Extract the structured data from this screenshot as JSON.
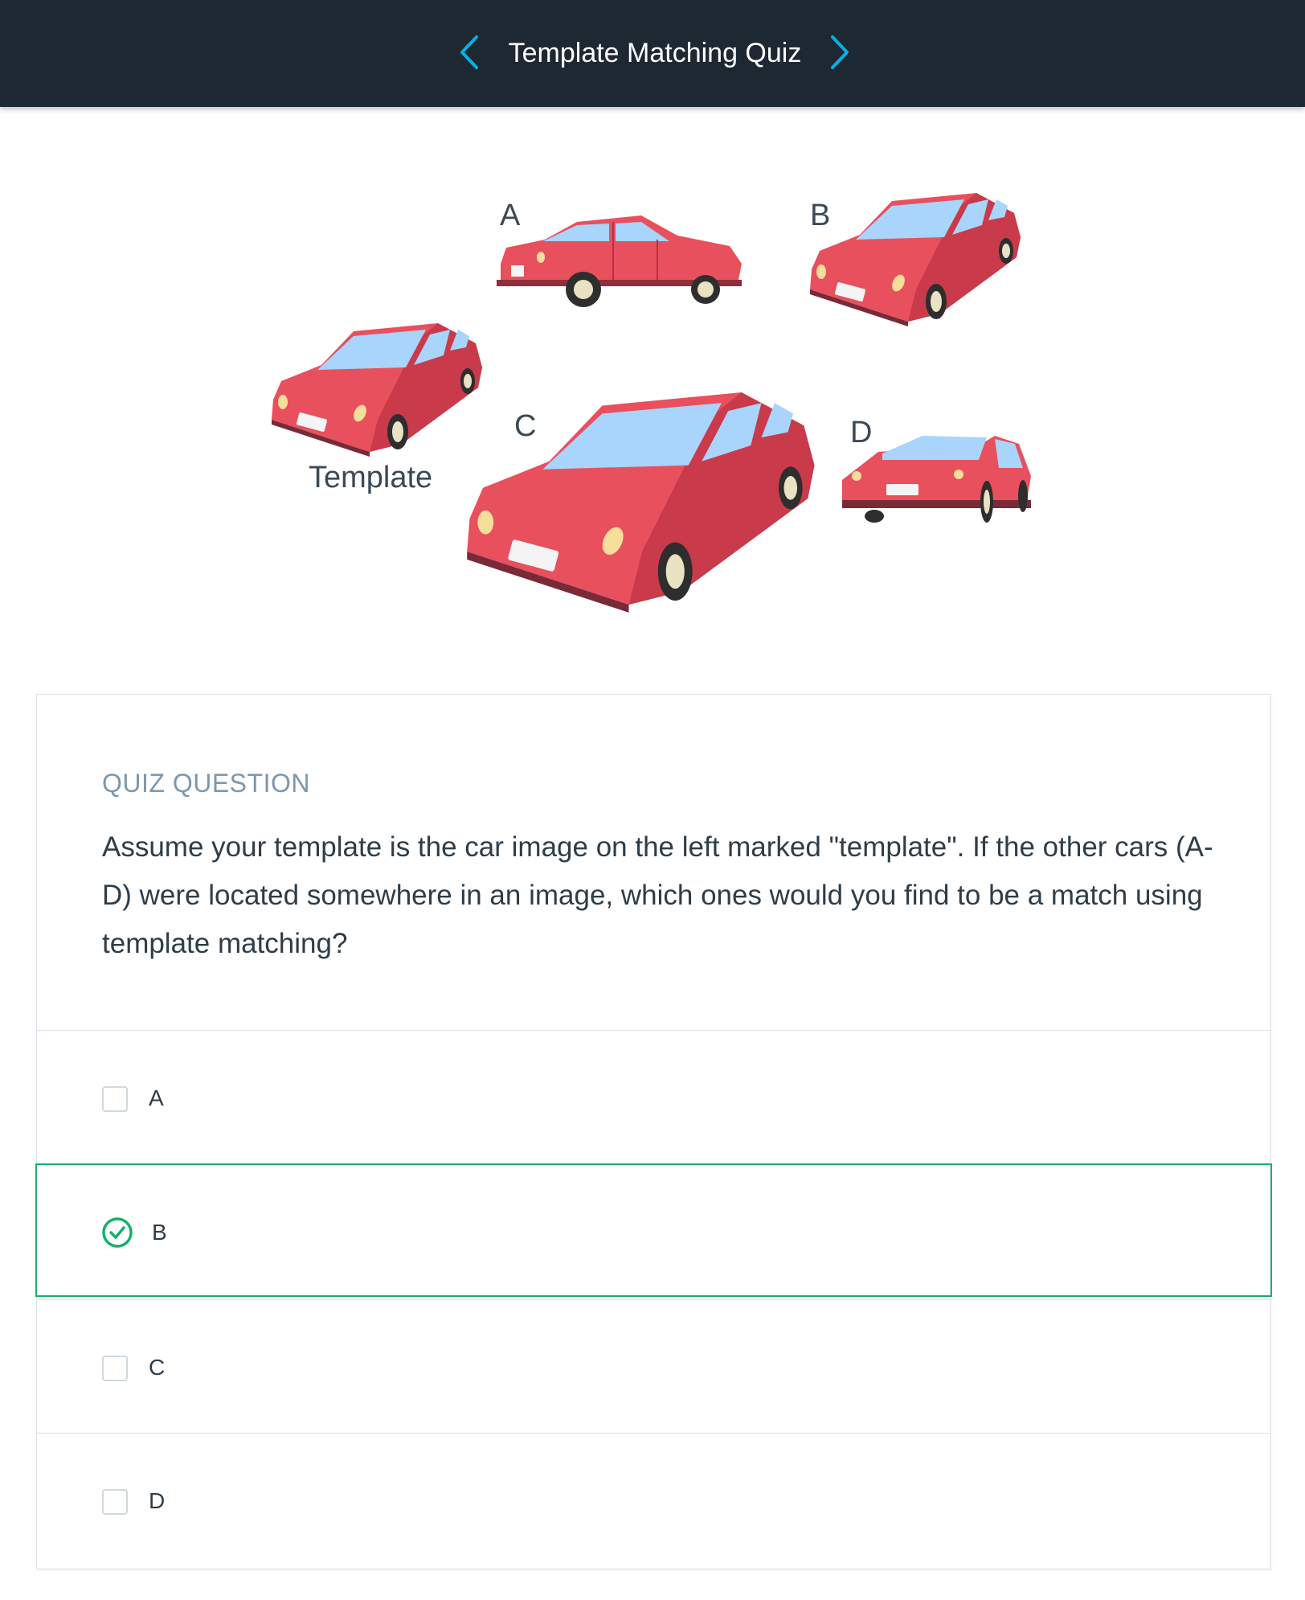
{
  "header": {
    "title": "Template Matching Quiz",
    "prev_icon": "chevron-left-icon",
    "next_icon": "chevron-right-icon",
    "accent_color": "#02b3e4"
  },
  "figure": {
    "labels": {
      "template": "Template",
      "a": "A",
      "b": "B",
      "c": "C",
      "d": "D"
    }
  },
  "quiz": {
    "kicker": "QUIZ QUESTION",
    "question": "Assume your template is the car image on the left marked \"template\". If the other cars (A-D) were located somewhere in an image, which ones would you find to be a match using template matching?",
    "options": [
      {
        "label": "A",
        "selected": false
      },
      {
        "label": "B",
        "selected": true
      },
      {
        "label": "C",
        "selected": false
      },
      {
        "label": "D",
        "selected": false
      }
    ],
    "selected_color": "#18b06b"
  }
}
